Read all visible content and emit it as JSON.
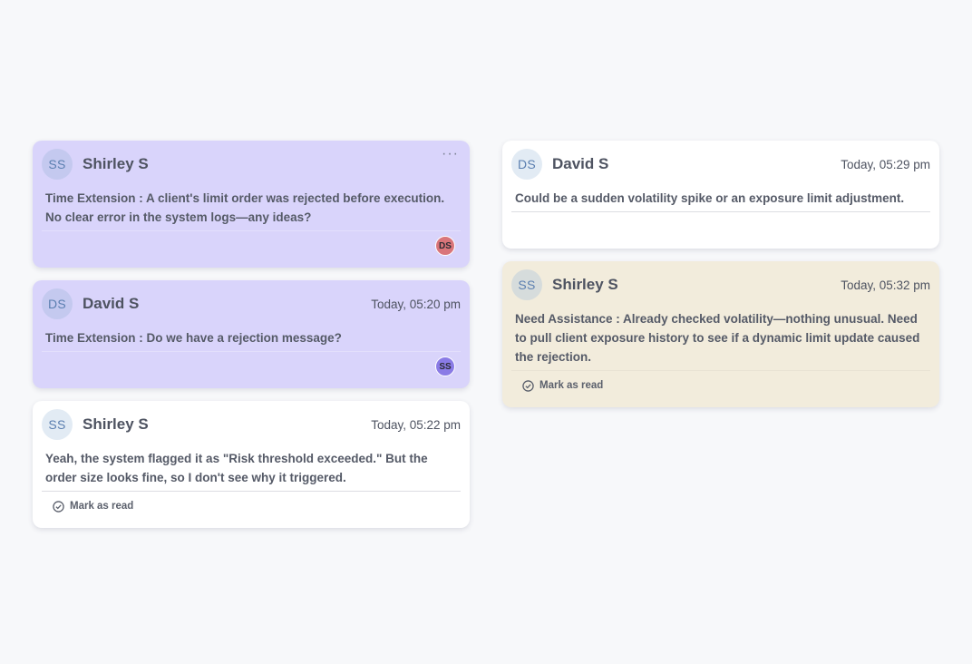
{
  "colors": {
    "purple_card": "#d9d4fb",
    "white_card": "#ffffff",
    "beige_card": "#f2ecdc",
    "ds_badge": "#d9757a",
    "ss_badge": "#8a7be6"
  },
  "left": [
    {
      "author": "Shirley S",
      "avatar": "SS",
      "time": "",
      "more": "···",
      "message": "Time Extension : A client's limit order was rejected before execution. No clear error in the system logs—any ideas?",
      "badge": "DS",
      "mark_read": ""
    },
    {
      "author": "David S",
      "avatar": "DS",
      "time": "Today, 05:20 pm",
      "message": "Time Extension : Do we have a rejection message?",
      "badge": "SS",
      "mark_read": ""
    },
    {
      "author": "Shirley S",
      "avatar": "SS",
      "time": "Today, 05:22 pm",
      "message": "Yeah, the system flagged it as \"Risk threshold exceeded.\" But the order size looks fine, so I don't see why it triggered.",
      "badge": "",
      "mark_read": "Mark as read"
    }
  ],
  "right": [
    {
      "author": "David S",
      "avatar": "DS",
      "time": "Today, 05:29 pm",
      "message": "Could be a sudden volatility spike or an exposure limit adjustment.",
      "badge": "",
      "mark_read": ""
    },
    {
      "author": "Shirley S",
      "avatar": "SS",
      "time": "Today, 05:32 pm",
      "message": "Need Assistance : Already checked volatility—nothing unusual. Need to pull client exposure history to see if a dynamic limit update caused the rejection.",
      "badge": "",
      "mark_read": "Mark as read"
    }
  ]
}
